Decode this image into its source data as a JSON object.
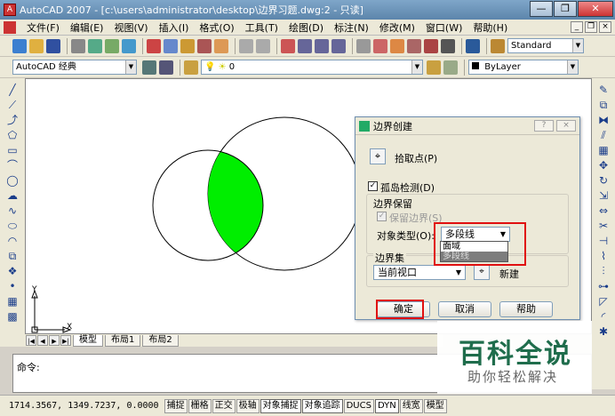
{
  "window": {
    "title": "AutoCAD 2007 - [c:\\users\\administrator\\desktop\\边界习题.dwg:2 - 只读]",
    "icon_name": "autocad-icon",
    "controls": [
      "—",
      "❐",
      "✕"
    ]
  },
  "menubar": {
    "items": [
      "文件(F)",
      "编辑(E)",
      "视图(V)",
      "插入(I)",
      "格式(O)",
      "工具(T)",
      "绘图(D)",
      "标注(N)",
      "修改(M)",
      "窗口(W)",
      "帮助(H)"
    ],
    "mdi_controls": [
      "_",
      "❐",
      "×"
    ]
  },
  "toolbar1": {
    "text_style": "Standard"
  },
  "toolbar2": {
    "workspace": "AutoCAD 经典",
    "layer": "0",
    "color": "ByLayer"
  },
  "canvas": {
    "axis_y": "Y",
    "axis_x": "X",
    "fill_color": "#00ee00"
  },
  "layout_tabs": {
    "nav": [
      "|◀",
      "◀",
      "▶",
      "▶|"
    ],
    "tabs": [
      "模型",
      "布局1",
      "布局2"
    ]
  },
  "command": {
    "prompt": "命令:"
  },
  "statusbar": {
    "coords": "1714.3567, 1349.7237, 0.0000",
    "buttons": [
      "捕捉",
      "栅格",
      "正交",
      "极轴",
      "对象捕捉",
      "对象追踪",
      "DUCS",
      "DYN",
      "线宽",
      "模型"
    ]
  },
  "dialog": {
    "title": "边界创建",
    "title_controls": [
      "?",
      "×"
    ],
    "pick_points": "拾取点(P)",
    "island_detection": "孤岛检测(D)",
    "island_checked": true,
    "boundary_retention": "边界保留",
    "retain_boundaries": "保留边界(S)",
    "object_type_label": "对象类型(O):",
    "object_type_value": "多段线",
    "dropdown_options": [
      "面域",
      "多段线"
    ],
    "boundary_set": "边界集",
    "boundary_set_value": "当前视口",
    "new_label": "新建",
    "ok": "确定",
    "cancel": "取消",
    "help": "帮助",
    "highlight_color": "#e01010"
  },
  "watermark": {
    "main": "百科全说",
    "sub": "助你轻松解决"
  }
}
